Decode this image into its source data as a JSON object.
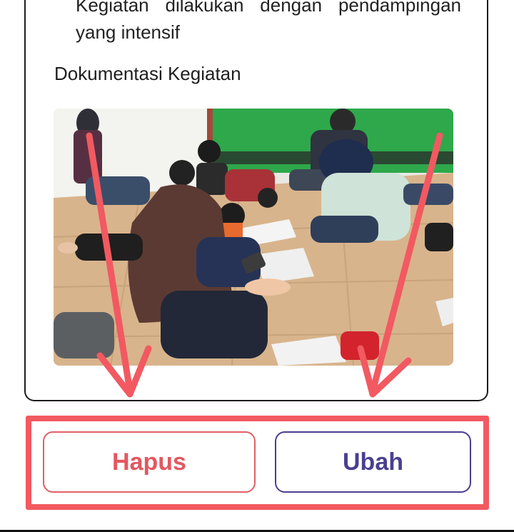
{
  "activity": {
    "description_line1_words": [
      "Kegiatan",
      "dilakukan",
      "dengan",
      "pendampingan"
    ],
    "description_line2": "yang intensif",
    "documentation_label": "Dokumentasi Kegiatan",
    "photo_icon": "activity-photo"
  },
  "actions": {
    "delete_label": "Hapus",
    "edit_label": "Ubah"
  },
  "annotation": {
    "color": "#f25961",
    "arrow_icon": "arrow-down-icon",
    "highlight": "action-buttons"
  },
  "colors": {
    "delete": "#e4575f",
    "edit": "#4a3f92"
  }
}
